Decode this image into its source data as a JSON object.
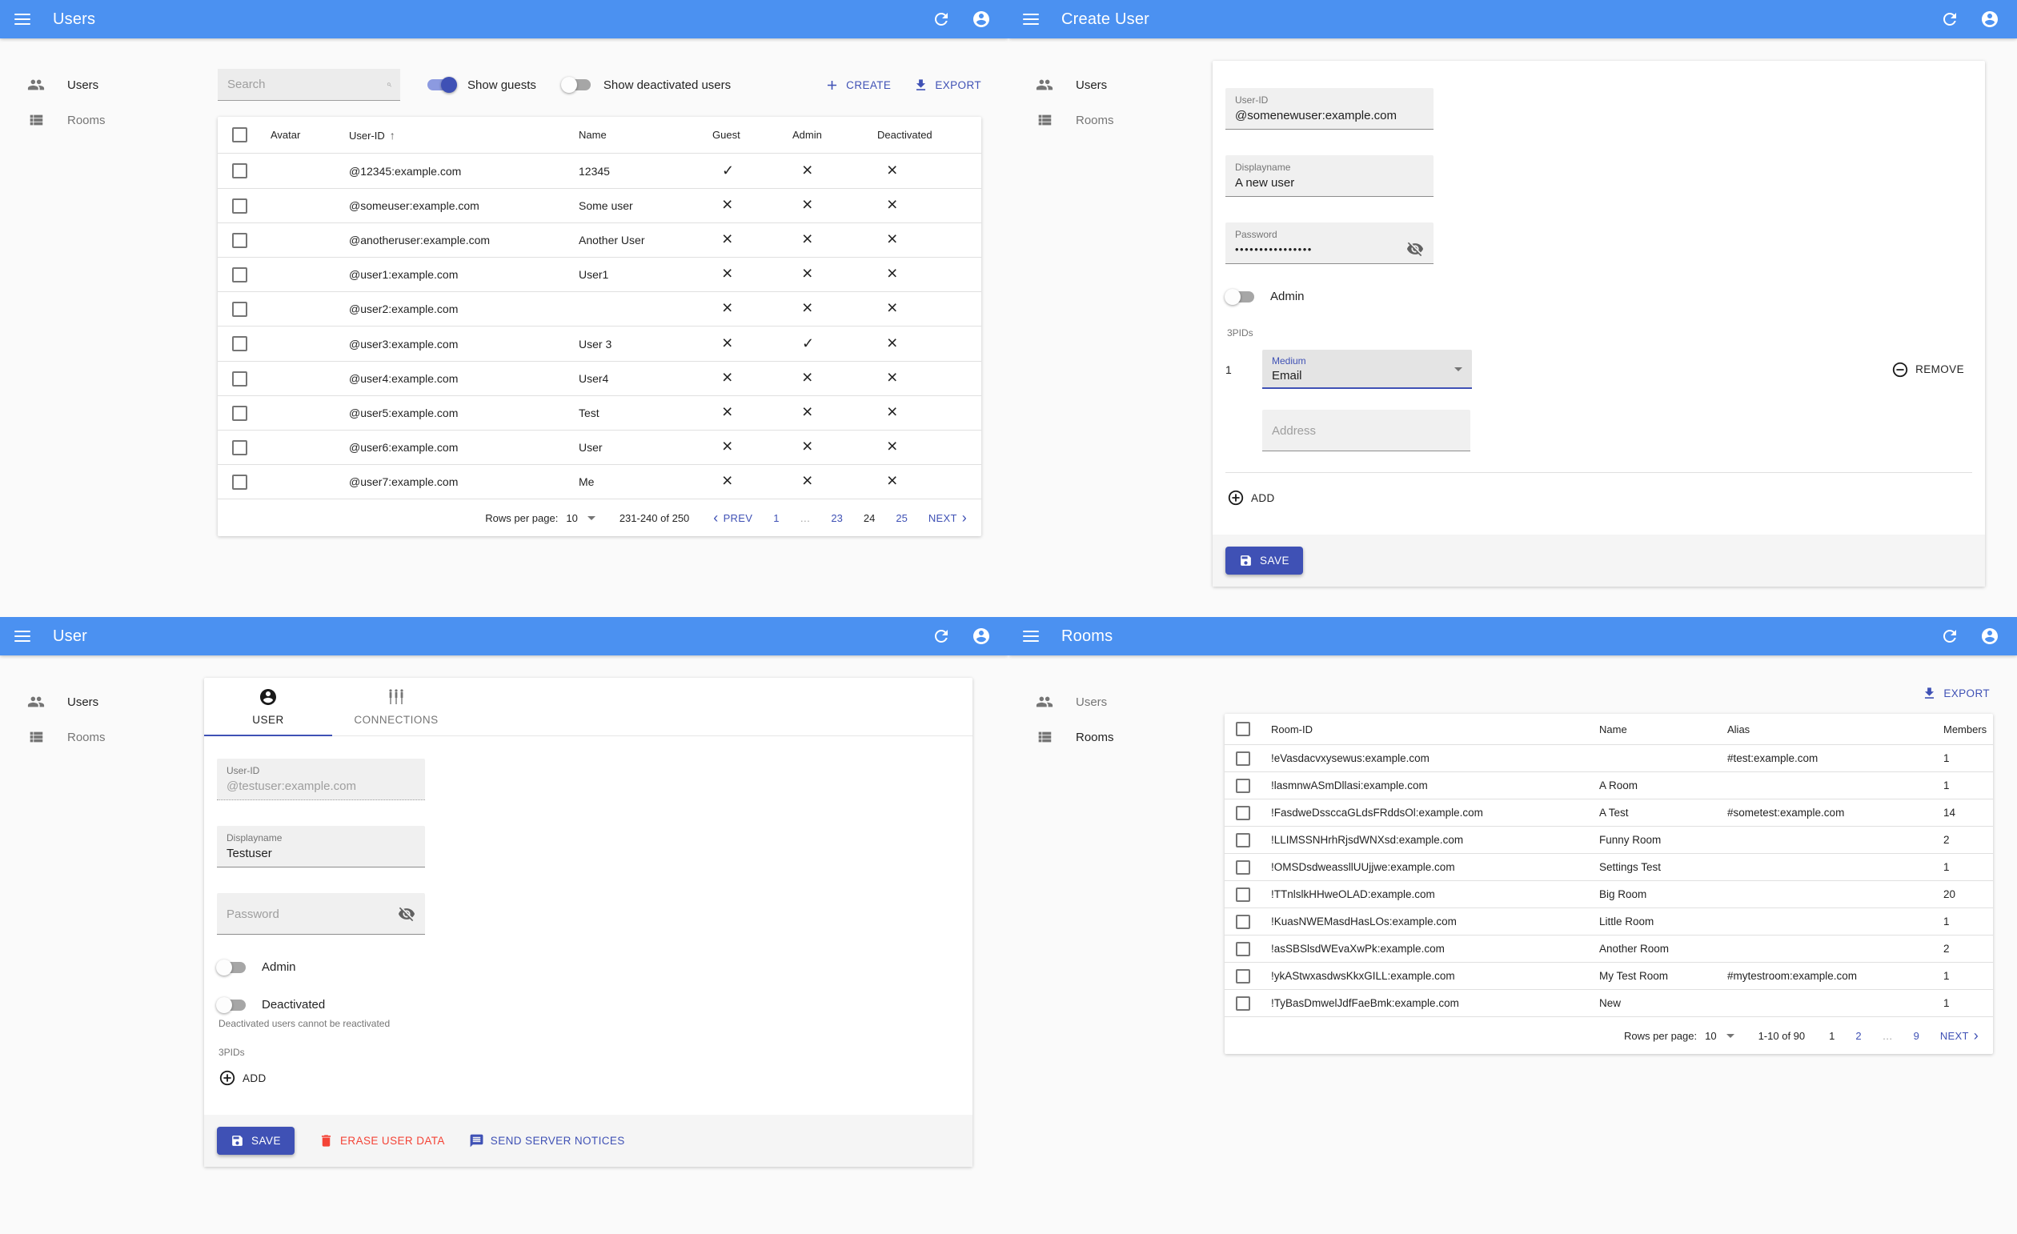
{
  "colors": {
    "appbar": "#4b91f1",
    "primary": "#3f51b5",
    "danger": "#f44336",
    "page_bg": "#fafafa"
  },
  "icons": {
    "check_glyph": "✓",
    "cross_glyph": "×",
    "prev_chevron": "‹",
    "next_chevron": "›",
    "sort_arrow": "↑"
  },
  "sidebar": {
    "users": "Users",
    "rooms": "Rooms"
  },
  "users_list": {
    "title": "Users",
    "search_placeholder": "Search",
    "show_guests_label": "Show guests",
    "show_deactivated_label": "Show deactivated users",
    "create_label": "CREATE",
    "export_label": "EXPORT",
    "columns": {
      "avatar": "Avatar",
      "user_id": "User-ID",
      "name": "Name",
      "guest": "Guest",
      "admin": "Admin",
      "deactivated": "Deactivated"
    },
    "rows": [
      {
        "user_id": "@12345:example.com",
        "name": "12345",
        "guest": true,
        "admin": false,
        "deactivated": false
      },
      {
        "user_id": "@someuser:example.com",
        "name": "Some user",
        "guest": false,
        "admin": false,
        "deactivated": false
      },
      {
        "user_id": "@anotheruser:example.com",
        "name": "Another User",
        "guest": false,
        "admin": false,
        "deactivated": false
      },
      {
        "user_id": "@user1:example.com",
        "name": "User1",
        "guest": false,
        "admin": false,
        "deactivated": false
      },
      {
        "user_id": "@user2:example.com",
        "name": "",
        "guest": false,
        "admin": false,
        "deactivated": false
      },
      {
        "user_id": "@user3:example.com",
        "name": "User 3",
        "guest": false,
        "admin": true,
        "deactivated": false
      },
      {
        "user_id": "@user4:example.com",
        "name": "User4",
        "guest": false,
        "admin": false,
        "deactivated": false
      },
      {
        "user_id": "@user5:example.com",
        "name": "Test",
        "guest": false,
        "admin": false,
        "deactivated": false
      },
      {
        "user_id": "@user6:example.com",
        "name": "User",
        "guest": false,
        "admin": false,
        "deactivated": false
      },
      {
        "user_id": "@user7:example.com",
        "name": "Me",
        "guest": false,
        "admin": false,
        "deactivated": false
      }
    ],
    "pagination": {
      "rows_per_page_label": "Rows per page:",
      "rows_per_page": "10",
      "range": "231-240 of 250",
      "prev": "PREV",
      "next": "NEXT",
      "pages": [
        "1",
        "…",
        "23",
        "24",
        "25"
      ],
      "current_page": "24"
    }
  },
  "create_user": {
    "title": "Create User",
    "fields": {
      "user_id": {
        "label": "User-ID",
        "value": "@somenewuser:example.com"
      },
      "displayname": {
        "label": "Displayname",
        "value": "A new user"
      },
      "password": {
        "label": "Password",
        "value": "••••••••••••••••"
      }
    },
    "admin_toggle_label": "Admin",
    "threepids_label": "3PIDs",
    "pid_index": "1",
    "medium": {
      "label": "Medium",
      "value": "Email"
    },
    "remove_label": "REMOVE",
    "address_placeholder": "Address",
    "add_label": "ADD",
    "save_label": "SAVE"
  },
  "user_detail": {
    "title": "User",
    "tabs": {
      "user": "USER",
      "connections": "CONNECTIONS"
    },
    "fields": {
      "user_id": {
        "label": "User-ID",
        "value": "@testuser:example.com"
      },
      "displayname": {
        "label": "Displayname",
        "value": "Testuser"
      }
    },
    "password_placeholder": "Password",
    "admin_toggle_label": "Admin",
    "deactivated_toggle_label": "Deactivated",
    "deactivated_helper": "Deactivated users cannot be reactivated",
    "threepids_label": "3PIDs",
    "add_label": "ADD",
    "save_label": "SAVE",
    "erase_label": "ERASE USER DATA",
    "notices_label": "SEND SERVER NOTICES"
  },
  "rooms_list": {
    "title": "Rooms",
    "export_label": "EXPORT",
    "columns": {
      "room_id": "Room-ID",
      "name": "Name",
      "alias": "Alias",
      "members": "Members"
    },
    "rows": [
      {
        "room_id": "!eVasdacvxysewus:example.com",
        "name": "",
        "alias": "#test:example.com",
        "members": "1"
      },
      {
        "room_id": "!lasmnwASmDllasi:example.com",
        "name": "A Room",
        "alias": "",
        "members": "1"
      },
      {
        "room_id": "!FasdweDssccaGLdsFRddsOl:example.com",
        "name": "A Test",
        "alias": "#sometest:example.com",
        "members": "14"
      },
      {
        "room_id": "!LLIMSSNHrhRjsdWNXsd:example.com",
        "name": "Funny Room",
        "alias": "",
        "members": "2"
      },
      {
        "room_id": "!OMSDsdweassllUUjjwe:example.com",
        "name": "Settings Test",
        "alias": "",
        "members": "1"
      },
      {
        "room_id": "!TTnlslkHHweOLAD:example.com",
        "name": "Big Room",
        "alias": "",
        "members": "20"
      },
      {
        "room_id": "!KuasNWEMasdHasLOs:example.com",
        "name": "Little Room",
        "alias": "",
        "members": "1"
      },
      {
        "room_id": "!asSBSlsdWEvaXwPk:example.com",
        "name": "Another Room",
        "alias": "",
        "members": "2"
      },
      {
        "room_id": "!ykAStwxasdwsKkxGILL:example.com",
        "name": "My Test Room",
        "alias": "#mytestroom:example.com",
        "members": "1"
      },
      {
        "room_id": "!TyBasDmwelJdfFaeBmk:example.com",
        "name": "New",
        "alias": "",
        "members": "1"
      }
    ],
    "pagination": {
      "rows_per_page_label": "Rows per page:",
      "rows_per_page": "10",
      "range": "1-10 of 90",
      "next": "NEXT",
      "pages": [
        "1",
        "2",
        "…",
        "9"
      ],
      "current_page": "1"
    }
  }
}
